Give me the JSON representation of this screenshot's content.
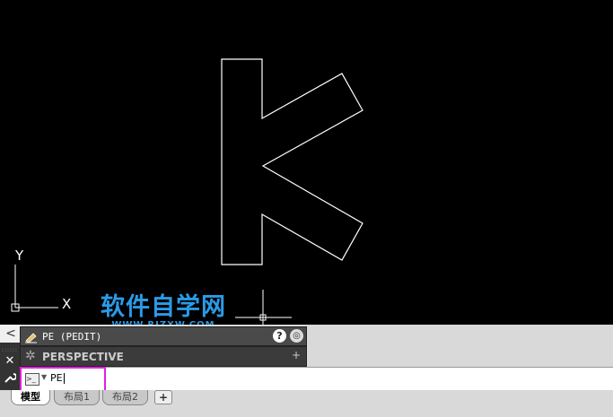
{
  "canvas": {
    "ucs": {
      "x_label": "X",
      "y_label": "Y"
    }
  },
  "watermark": {
    "title": "软件自学网",
    "url": "WWW.RJZXW.COM"
  },
  "side_panel": {
    "collapse_label": "<",
    "close_label": "✕"
  },
  "tooltip": {
    "title": "PE (PEDIT)",
    "help_label": "?"
  },
  "suggestion": {
    "label": "PERSPECTIVE",
    "expand_label": "+"
  },
  "command_line": {
    "input_value": "PE"
  },
  "tabs": [
    {
      "label": "模型",
      "active": true
    },
    {
      "label": "布局1",
      "active": false
    },
    {
      "label": "布局2",
      "active": false
    }
  ],
  "tabs_add_label": "+",
  "colors": {
    "highlight": "#e020e0",
    "watermark": "#2a9be8",
    "canvas": "#000000"
  }
}
